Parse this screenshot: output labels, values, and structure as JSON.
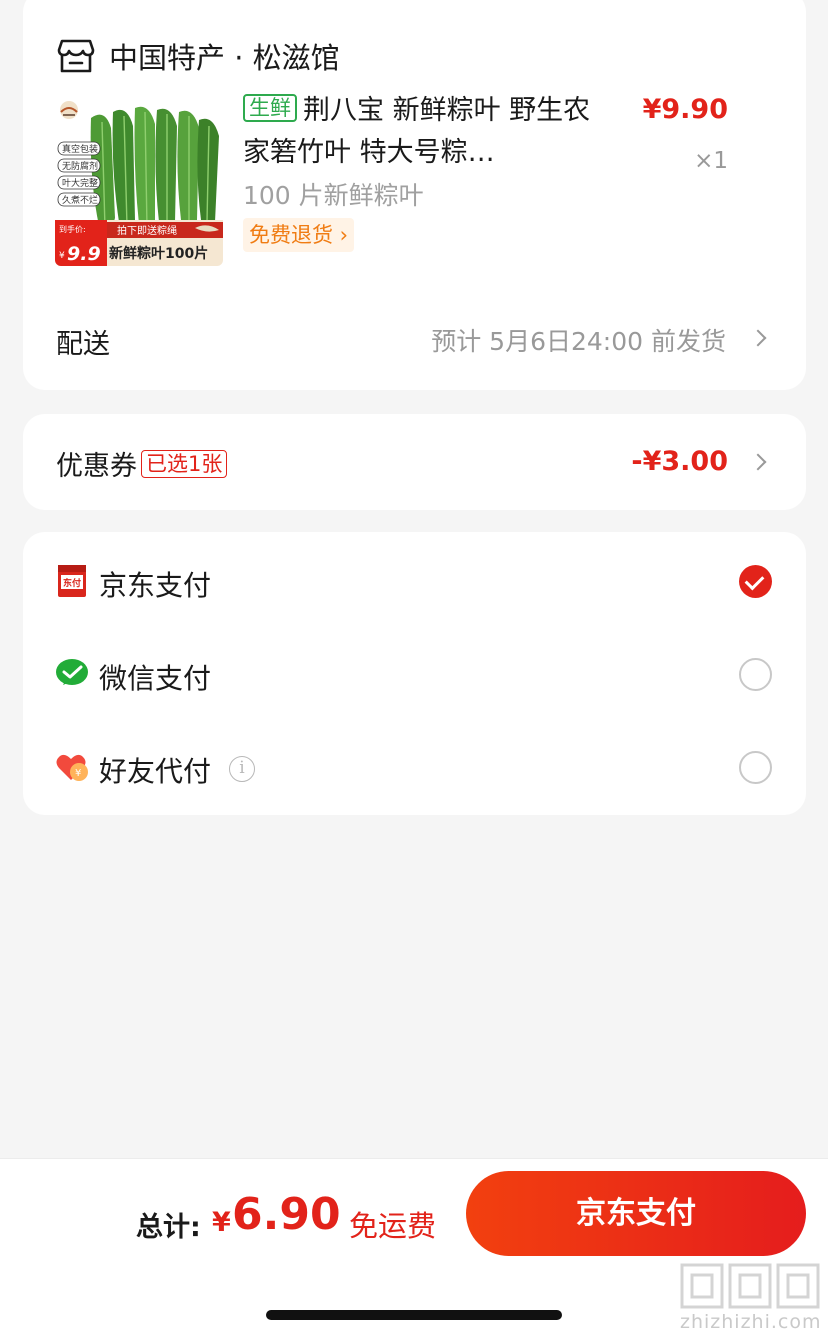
{
  "order": {
    "shop_name": "中国特产 · 松滋馆",
    "product": {
      "tag": "生鲜",
      "title": "荆八宝 新鲜粽叶 野生农家箬竹叶 特大号粽…",
      "sku": "100 片新鲜粽叶",
      "return_tag": "免费退货 ›",
      "price": "¥9.90",
      "quantity": "×1",
      "thumbnail": {
        "badges": [
          "真空包装",
          "无防腐剂",
          "叶大完整",
          "久煮不烂"
        ],
        "promo_top": "拍下即送粽绳",
        "promo_price_label": "到手价:",
        "promo_price": "9.9",
        "promo_bottom": "新鲜粽叶100片"
      }
    },
    "shipping": {
      "label": "配送",
      "value": "预计 5月6日24:00 前发货"
    }
  },
  "coupon": {
    "label": "优惠券",
    "badge": "已选1张",
    "value": "-¥3.00"
  },
  "payment": {
    "methods": [
      {
        "label": "京东支付",
        "icon": "jd-pay-icon",
        "selected": true
      },
      {
        "label": "微信支付",
        "icon": "wechat-pay-icon",
        "selected": false
      },
      {
        "label": "好友代付",
        "icon": "friend-pay-icon",
        "selected": false,
        "info": "i"
      }
    ]
  },
  "footer": {
    "total_label": "总计:",
    "currency": "¥",
    "total": "6.90",
    "free_shipping": "免运费",
    "pay_button": "京东支付"
  },
  "watermark": {
    "text": "zhizhizhi.com"
  },
  "colors": {
    "accent": "#e2231a",
    "fresh_green": "#2eaa4e",
    "return_orange": "#f07c13"
  }
}
